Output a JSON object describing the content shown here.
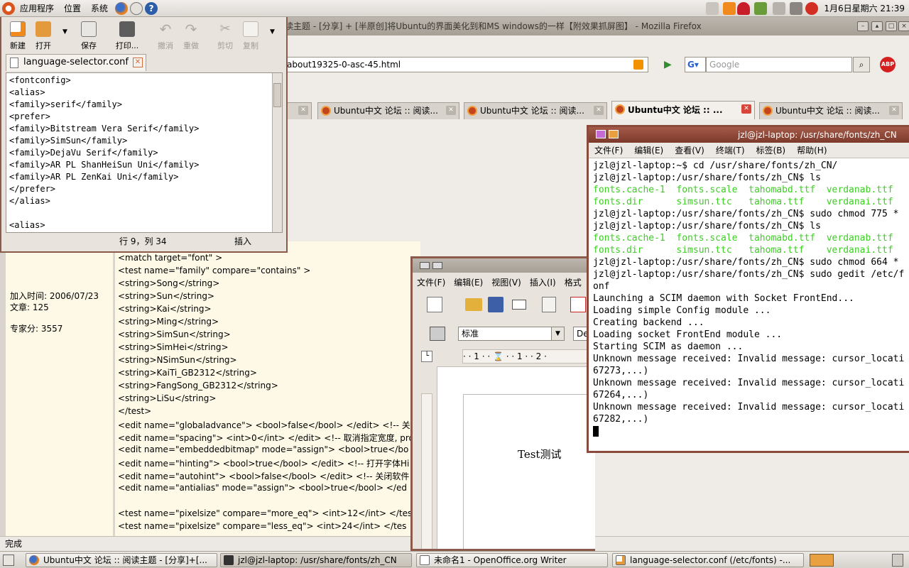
{
  "top_panel": {
    "menus": [
      "应用程序",
      "位置",
      "系统"
    ],
    "clock": "1月6日星期六 21:39"
  },
  "firefox": {
    "title": "读主题 - [分享] + [半原创]将Ubuntu的界面美化到和MS windows的一样【附效果抓屏图】 - Mozilla Firefox",
    "url": "/about19325-0-asc-45.html",
    "search_placeholder": "Google",
    "tabs": [
      {
        "label": "Ubuntu中文 论坛 :: 阅读...",
        "active": false
      },
      {
        "label": "Ubuntu中文 论坛 :: 阅读...",
        "active": false
      },
      {
        "label": "Ubuntu中文 论坛 :: ...",
        "active": true
      },
      {
        "label": "Ubuntu中文 论坛 :: 阅读...",
        "active": false
      }
    ],
    "status": "完成"
  },
  "forum": {
    "join_time": "加入时间: 2006/07/23",
    "posts": "文章: 125",
    "score": "专家分: 3557",
    "code_lines": [
      "<match target=\"font\" >",
      "<test name=\"family\" compare=\"contains\" >",
      "<string>Song</string>",
      "<string>Sun</string>",
      "<string>Kai</string>",
      "<string>Ming</string>",
      "<string>SimSun</string>",
      "<string>SimHei</string>",
      "<string>NSimSun</string>",
      "<string>KaiTi_GB2312</string>",
      "<string>FangSong_GB2312</string>",
      "<string>LiSu</string>",
      "</test>",
      "<edit name=\"globaladvance\"> <bool>false</bool> </edit> <!-- 关",
      "<edit name=\"spacing\"> <int>0</int> </edit> <!-- 取消指定宽度, pro",
      "<edit name=\"embeddedbitmap\" mode=\"assign\"> <bool>true</bo",
      "<edit name=\"hinting\"> <bool>true</bool> </edit> <!-- 打开字体Hi",
      "<edit name=\"autohint\"> <bool>false</bool> </edit> <!-- 关闭软件",
      "<edit name=\"antialias\" mode=\"assign\"> <bool>true</bool> </ed",
      "",
      "<test name=\"pixelsize\" compare=\"more_eq\"> <int>12</int> </tes",
      "<test name=\"pixelsize\" compare=\"less_eq\"> <int>24</int> </tes"
    ]
  },
  "gedit": {
    "toolbar": [
      {
        "label": "新建",
        "icon": "new-doc-icon",
        "enabled": true
      },
      {
        "label": "打开",
        "icon": "folder-open-icon",
        "enabled": true
      },
      {
        "label": "保存",
        "icon": "save-icon",
        "enabled": true
      },
      {
        "label": "打印...",
        "icon": "printer-icon",
        "enabled": true
      },
      {
        "label": "撤消",
        "icon": "undo-icon",
        "enabled": false
      },
      {
        "label": "重做",
        "icon": "redo-icon",
        "enabled": false
      },
      {
        "label": "剪切",
        "icon": "cut-icon",
        "enabled": false
      },
      {
        "label": "复制",
        "icon": "copy-icon",
        "enabled": false
      }
    ],
    "tab_label": "language-selector.conf",
    "lines": [
      "<fontconfig>",
      "<alias>",
      "<family>serif</family>",
      "<prefer>",
      "<family>Bitstream Vera Serif</family>",
      "<family>SimSun</family>",
      "<family>DejaVu Serif</family>",
      "<family>AR PL ShanHeiSun Uni</family>",
      "<family>AR PL ZenKai Uni</family>",
      "</prefer>",
      "</alias>",
      "",
      "<alias>"
    ],
    "cursor_pos": "行 9，列 34",
    "mode": "插入"
  },
  "terminal": {
    "title": "jzl@jzl-laptop: /usr/share/fonts/zh_CN",
    "menus": [
      "文件(F)",
      "编辑(E)",
      "查看(V)",
      "终端(T)",
      "标签(B)",
      "帮助(H)"
    ],
    "lines": [
      {
        "text": "jzl@jzl-laptop:~$ cd /usr/share/fonts/zh_CN/",
        "color": "normal"
      },
      {
        "text": "jzl@jzl-laptop:/usr/share/fonts/zh_CN$ ls",
        "color": "normal"
      },
      {
        "text": "fonts.cache-1  fonts.scale  tahomabd.ttf  verdanab.ttf",
        "color": "green"
      },
      {
        "text": "fonts.dir      simsun.ttc   tahoma.ttf    verdanai.ttf",
        "color": "green"
      },
      {
        "text": "jzl@jzl-laptop:/usr/share/fonts/zh_CN$ sudo chmod 775 *",
        "color": "normal"
      },
      {
        "text": "jzl@jzl-laptop:/usr/share/fonts/zh_CN$ ls",
        "color": "normal"
      },
      {
        "text": "fonts.cache-1  fonts.scale  tahomabd.ttf  verdanab.ttf",
        "color": "green"
      },
      {
        "text": "fonts.dir      simsun.ttc   tahoma.ttf    verdanai.ttf",
        "color": "green"
      },
      {
        "text": "jzl@jzl-laptop:/usr/share/fonts/zh_CN$ sudo chmod 664 *",
        "color": "normal"
      },
      {
        "text": "jzl@jzl-laptop:/usr/share/fonts/zh_CN$ sudo gedit /etc/f",
        "color": "normal"
      },
      {
        "text": "onf",
        "color": "normal"
      },
      {
        "text": "Launching a SCIM daemon with Socket FrontEnd...",
        "color": "normal"
      },
      {
        "text": "Loading simple Config module ...",
        "color": "normal"
      },
      {
        "text": "Creating backend ...",
        "color": "normal"
      },
      {
        "text": "Loading socket FrontEnd module ...",
        "color": "normal"
      },
      {
        "text": "Starting SCIM as daemon ...",
        "color": "normal"
      },
      {
        "text": "Unknown message received: Invalid message: cursor_locati",
        "color": "normal"
      },
      {
        "text": "67273,...)",
        "color": "normal"
      },
      {
        "text": "Unknown message received: Invalid message: cursor_locati",
        "color": "normal"
      },
      {
        "text": "67264,...)",
        "color": "normal"
      },
      {
        "text": "Unknown message received: Invalid message: cursor_locati",
        "color": "normal"
      },
      {
        "text": "67282,...)",
        "color": "normal"
      }
    ]
  },
  "writer": {
    "menus": [
      "文件(F)",
      "编辑(E)",
      "视图(V)",
      "插入(I)",
      "格式"
    ],
    "style_value": "标准",
    "font_value": "De",
    "ruler": "· · 1 · · ⌛ · · 1 · · 2 ·",
    "doc_text": "Test测试"
  },
  "taskbar": [
    {
      "label": "Ubuntu中文 论坛 :: 阅读主题 - [分享]+[...",
      "icon": "firefox-icon"
    },
    {
      "label": "jzl@jzl-laptop: /usr/share/fonts/zh_CN",
      "icon": "terminal-icon"
    },
    {
      "label": "未命名1 - OpenOffice.org Writer",
      "icon": "writer-icon"
    },
    {
      "label": "language-selector.conf (/etc/fonts) -...",
      "icon": "gedit-icon"
    }
  ]
}
